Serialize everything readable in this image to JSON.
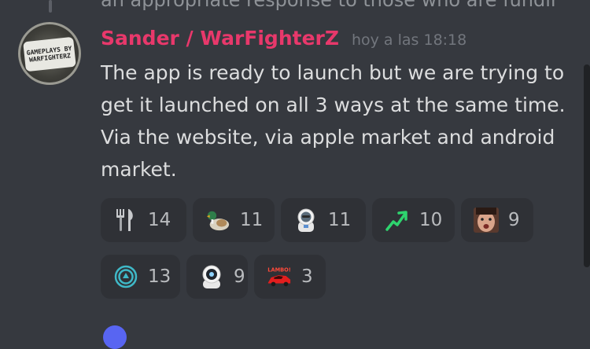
{
  "previous_message": {
    "text": "an appropriate response to those who are fundin..."
  },
  "message": {
    "avatar_text": "GAMEPLAYS BY WARFIGHTERZ",
    "username": "Sander  / WarFighterZ",
    "timestamp": "hoy a las 18:18",
    "content": "The app is ready to launch but we are trying to get it launched on all 3 ways at the same time. Via the website, via apple market and android market."
  },
  "reactions": [
    {
      "icon": "fork-knife-icon",
      "count": "14"
    },
    {
      "icon": "duck-icon",
      "count": "11"
    },
    {
      "icon": "astronaut-emoji-icon",
      "count": "11"
    },
    {
      "icon": "stonks-arrow-icon",
      "count": "10"
    },
    {
      "icon": "face-emote-icon",
      "count": "9"
    },
    {
      "icon": "circle-logo-icon",
      "count": "13"
    },
    {
      "icon": "astronaut-helmet-icon",
      "count": "9"
    },
    {
      "icon": "lambo-car-icon",
      "count": "3",
      "label": "LAMBO!"
    }
  ],
  "colors": {
    "background": "#36393f",
    "username": "#e8386b",
    "reaction_bg": "#2f3136"
  }
}
